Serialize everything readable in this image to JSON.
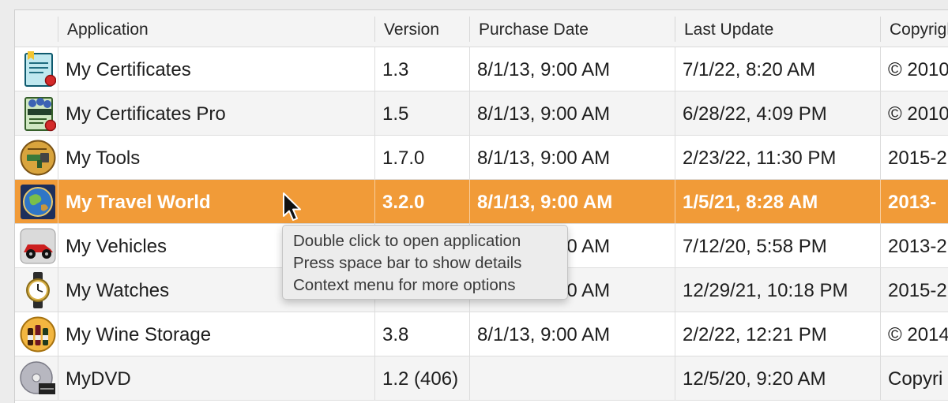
{
  "columns": [
    "Application",
    "Version",
    "Purchase Date",
    "Last Update",
    "Copyright"
  ],
  "rows": [
    {
      "name": "My Certificates",
      "version": "1.3",
      "purchase": "8/1/13, 9:00 AM",
      "update": "7/1/22, 8:20 AM",
      "copyright": "© 2010",
      "icon": "certificate-icon"
    },
    {
      "name": "My Certificates Pro",
      "version": "1.5",
      "purchase": "8/1/13, 9:00 AM",
      "update": "6/28/22, 4:09 PM",
      "copyright": "© 2010",
      "icon": "certificate-pro-icon"
    },
    {
      "name": "My Tools",
      "version": "1.7.0",
      "purchase": "8/1/13, 9:00 AM",
      "update": "2/23/22, 11:30 PM",
      "copyright": "2015-2",
      "icon": "tools-icon"
    },
    {
      "name": "My Travel World",
      "version": "3.2.0",
      "purchase": "8/1/13, 9:00 AM",
      "update": "1/5/21, 8:28 AM",
      "copyright": "2013-",
      "icon": "globe-icon"
    },
    {
      "name": "My Vehicles",
      "version": "",
      "purchase": "8/1/13, 9:00 AM",
      "update": "7/12/20, 5:58 PM",
      "copyright": "2013-2",
      "icon": "car-icon"
    },
    {
      "name": "My Watches",
      "version": "",
      "purchase": "8/1/13, 9:00 AM",
      "update": "12/29/21, 10:18 PM",
      "copyright": "2015-2",
      "icon": "watch-icon"
    },
    {
      "name": "My Wine Storage",
      "version": "3.8",
      "purchase": "8/1/13, 9:00 AM",
      "update": "2/2/22, 12:21 PM",
      "copyright": "© 2014",
      "icon": "wine-icon"
    },
    {
      "name": "MyDVD",
      "version": "1.2 (406)",
      "purchase": "",
      "update": "12/5/20, 9:20 AM",
      "copyright": "Copyri",
      "icon": "dvd-icon"
    }
  ],
  "selected_row": 3,
  "tooltip": {
    "line1": "Double click to open application",
    "line2": "Press space bar to show details",
    "line3": "Context menu for more options"
  },
  "colors": {
    "selection": "#f19b38"
  }
}
